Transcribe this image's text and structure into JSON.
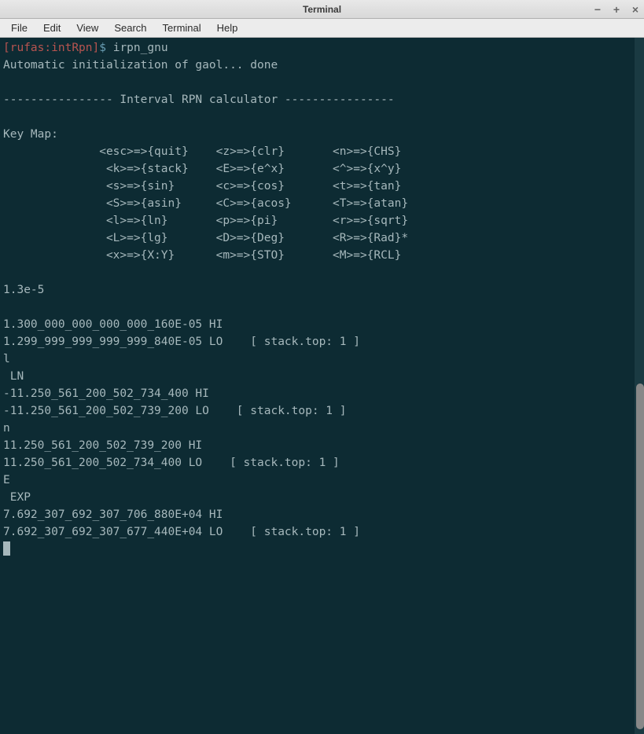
{
  "window": {
    "title": "Terminal"
  },
  "menu": {
    "file": "File",
    "edit": "Edit",
    "view": "View",
    "search": "Search",
    "terminal": "Terminal",
    "help": "Help"
  },
  "prompt": {
    "open": "[",
    "host": "rufas",
    "colon": ":",
    "path": "intRpn",
    "close": "]",
    "symbol": "$",
    "command": "irpn_gnu"
  },
  "output": {
    "init": "Automatic initialization of gaol... done",
    "sep": "---------------- Interval RPN calculator ----------------",
    "keymap_header": "Key Map:",
    "km1": "              <esc>=>{quit}    <z>=>{clr}       <n>=>{CHS}",
    "km2": "               <k>=>{stack}    <E>=>{e^x}       <^>=>{x^y}",
    "km3": "               <s>=>{sin}      <c>=>{cos}       <t>=>{tan}",
    "km4": "               <S>=>{asin}     <C>=>{acos}      <T>=>{atan}",
    "km5": "               <l>=>{ln}       <p>=>{pi}        <r>=>{sqrt}",
    "km6": "               <L>=>{lg}       <D>=>{Deg}       <R>=>{Rad}*",
    "km7": "               <x>=>{X:Y}      <m>=>{STO}       <M>=>{RCL}",
    "input1": "1.3e-5",
    "out1_hi": "1.300_000_000_000_000_160E-05 HI",
    "out1_lo": "1.299_999_999_999_999_840E-05 LO    [ stack.top: 1 ]",
    "cmd_l": "l",
    "op_ln": " LN",
    "out2_hi": "-11.250_561_200_502_734_400 HI",
    "out2_lo": "-11.250_561_200_502_739_200 LO    [ stack.top: 1 ]",
    "cmd_n": "n",
    "out3_hi": "11.250_561_200_502_739_200 HI",
    "out3_lo": "11.250_561_200_502_734_400 LO    [ stack.top: 1 ]",
    "cmd_E": "E",
    "op_exp": " EXP",
    "out4_hi": "7.692_307_692_307_706_880E+04 HI",
    "out4_lo": "7.692_307_692_307_677_440E+04 LO    [ stack.top: 1 ]"
  }
}
